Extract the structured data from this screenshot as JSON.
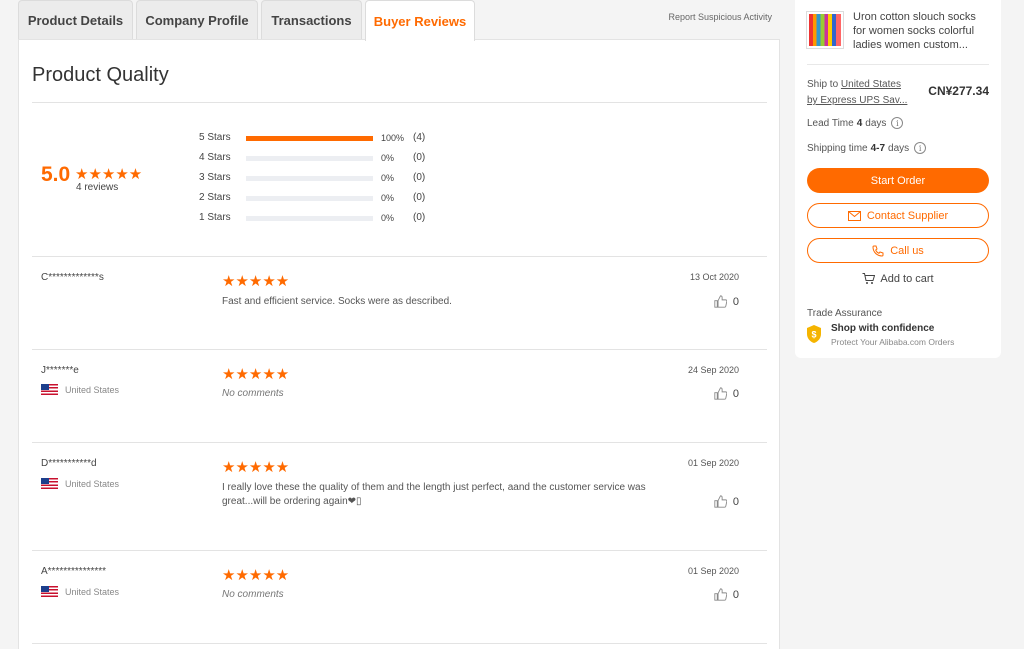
{
  "tabs": [
    {
      "label": "Product Details"
    },
    {
      "label": "Company Profile"
    },
    {
      "label": "Transactions"
    },
    {
      "label": "Buyer Reviews",
      "active": true
    }
  ],
  "report_link": "Report Suspicious Activity",
  "section_title": "Product Quality",
  "summary": {
    "score": "5.0",
    "stars": "★★★★★",
    "reviews_text": "4 reviews"
  },
  "distribution": [
    {
      "label": "5 Stars",
      "fraction": 1.0,
      "pct": "100%",
      "count": "(4)"
    },
    {
      "label": "4 Stars",
      "fraction": 0.0,
      "pct": "0%",
      "count": "(0)"
    },
    {
      "label": "3 Stars",
      "fraction": 0.0,
      "pct": "0%",
      "count": "(0)"
    },
    {
      "label": "2 Stars",
      "fraction": 0.0,
      "pct": "0%",
      "count": "(0)"
    },
    {
      "label": "1 Stars",
      "fraction": 0.0,
      "pct": "0%",
      "count": "(0)"
    }
  ],
  "reviews": [
    {
      "name": "C*************s",
      "country": "",
      "stars": "★★★★★",
      "text": "Fast and efficient service. Socks were as described.",
      "date": "13 Oct 2020",
      "likes": "0"
    },
    {
      "name": "J*******e",
      "country": "United States",
      "stars": "★★★★★",
      "text": "No comments",
      "date": "24 Sep 2020",
      "likes": "0"
    },
    {
      "name": "D***********d",
      "country": "United States",
      "stars": "★★★★★",
      "text": "I really love these the quality of them and the length just perfect, aand the customer service was great...will be ordering again❤▯",
      "date": "01 Sep 2020",
      "likes": "0"
    },
    {
      "name": "A***************",
      "country": "United States",
      "stars": "★★★★★",
      "text": "No comments",
      "date": "01 Sep 2020",
      "likes": "0"
    }
  ],
  "sidebar": {
    "product_title": "Uron cotton slouch socks for women socks colorful ladies women custom...",
    "ship_to_prefix": "Ship to ",
    "ship_to_country": "United States",
    "ship_by": "by Express UPS Sav...",
    "price": "CN¥277.34",
    "lead_time_label": "Lead Time",
    "lead_time_value": "4",
    "lead_time_unit": "days",
    "shipping_label": "Shipping time",
    "shipping_value": "4-7",
    "shipping_unit": "days",
    "start_order": "Start Order",
    "contact_supplier": "Contact Supplier",
    "call_us": "Call us",
    "add_to_cart": "Add to cart",
    "trade_assurance": "Trade Assurance",
    "shop_confidence": "Shop with confidence",
    "protect_orders": "Protect Your Alibaba.com Orders",
    "info_icon": "i"
  },
  "colors": {
    "accent": "#ff6a00"
  }
}
